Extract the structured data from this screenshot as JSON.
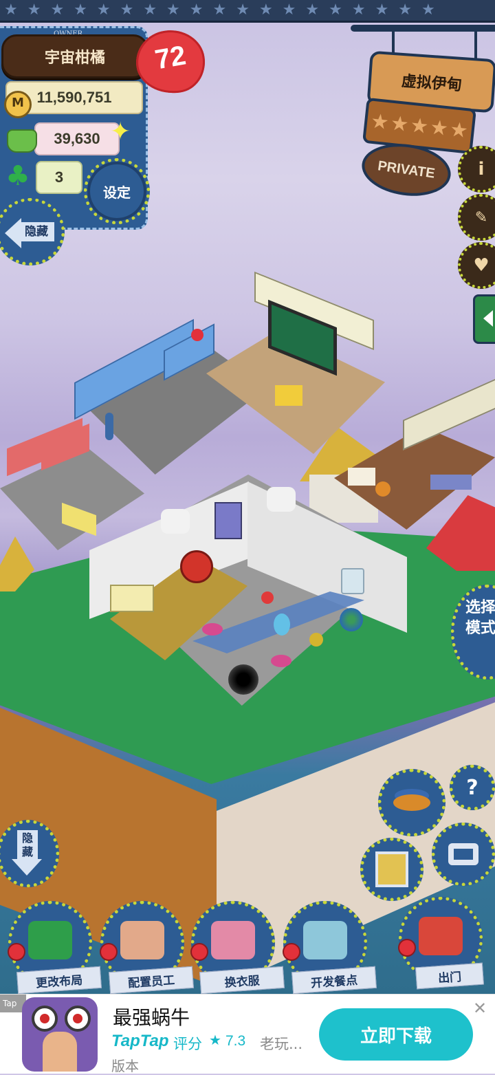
{
  "owner": {
    "label": "OWNER",
    "name": "宇宙柑橘",
    "level": "72"
  },
  "stats": {
    "money": "11,590,751",
    "food": "39,630",
    "clover": "3"
  },
  "buttons": {
    "settings": "设定",
    "hide_top": "隐藏",
    "hide_bottom": "隐藏",
    "select_mode": "选择模式"
  },
  "shop_sign": {
    "name": "虚拟伊甸",
    "stars": 5,
    "status": "PRIVATE"
  },
  "side_icons": [
    "info-icon",
    "book-icon",
    "heart-icon"
  ],
  "bottom_menu": [
    {
      "label": "更改布局",
      "icon": "table-icon",
      "color": "#2e9e4a"
    },
    {
      "label": "配置员工",
      "icon": "bear-icon",
      "color": "#e2a98a"
    },
    {
      "label": "换衣服",
      "icon": "shirt-icon",
      "color": "#e38aa7"
    },
    {
      "label": "开发餐点",
      "icon": "knife-icon",
      "color": "#8ec7da"
    },
    {
      "label": "出门",
      "icon": "door-icon",
      "color": "#d9473a"
    }
  ],
  "ad": {
    "tag": "Tap",
    "title": "最强蜗牛",
    "brand": "TapTap",
    "rating_label": "评分",
    "rating": "7.3",
    "desc": "老玩...",
    "desc2": "版本",
    "cta": "立即下载"
  }
}
